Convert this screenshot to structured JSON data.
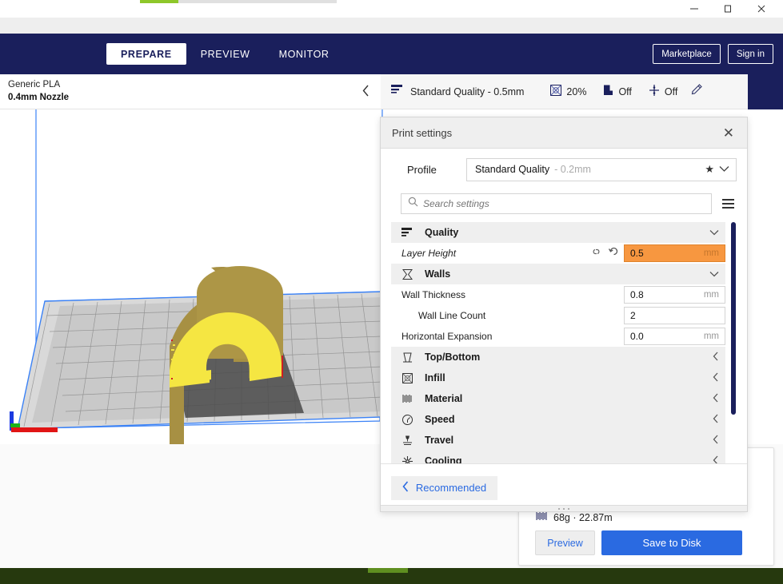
{
  "window": {
    "minimize_label": "minimize",
    "maximize_label": "maximize",
    "close_label": "close"
  },
  "header": {
    "tabs": [
      {
        "label": "PREPARE",
        "active": true
      },
      {
        "label": "PREVIEW",
        "active": false
      },
      {
        "label": "MONITOR",
        "active": false
      }
    ],
    "marketplace_label": "Marketplace",
    "signin_label": "Sign in"
  },
  "config_bar": {
    "material_name": "Generic PLA",
    "nozzle": "0.4mm Nozzle",
    "profile_summary": "Standard Quality - 0.5mm",
    "infill_value": "20%",
    "support_value": "Off",
    "adhesion_value": "Off"
  },
  "dialog": {
    "title": "Print settings",
    "profile_label": "Profile",
    "profile_name": "Standard Quality",
    "profile_sub": "- 0.2mm",
    "search_placeholder": "Search settings",
    "search_value": "",
    "recommended_label": "Recommended",
    "categories": [
      {
        "name": "Quality",
        "icon": "quality-icon",
        "expanded": true,
        "settings": [
          {
            "label": "Layer Height",
            "value": "0.5",
            "unit": "mm",
            "highlighted": true,
            "italic": true,
            "indent": false,
            "has_link_icon": true,
            "has_revert_icon": true
          }
        ]
      },
      {
        "name": "Walls",
        "icon": "walls-icon",
        "expanded": true,
        "settings": [
          {
            "label": "Wall Thickness",
            "value": "0.8",
            "unit": "mm",
            "highlighted": false,
            "italic": false,
            "indent": false,
            "has_link_icon": false,
            "has_revert_icon": false
          },
          {
            "label": "Wall Line Count",
            "value": "2",
            "unit": "",
            "highlighted": false,
            "italic": false,
            "indent": true,
            "has_link_icon": false,
            "has_revert_icon": false
          },
          {
            "label": "Horizontal Expansion",
            "value": "0.0",
            "unit": "mm",
            "highlighted": false,
            "italic": false,
            "indent": false,
            "has_link_icon": false,
            "has_revert_icon": false
          }
        ]
      },
      {
        "name": "Top/Bottom",
        "icon": "topbottom-icon",
        "expanded": false,
        "settings": []
      },
      {
        "name": "Infill",
        "icon": "infill-icon",
        "expanded": false,
        "settings": []
      },
      {
        "name": "Material",
        "icon": "material-icon",
        "expanded": false,
        "settings": []
      },
      {
        "name": "Speed",
        "icon": "speed-icon",
        "expanded": false,
        "settings": []
      },
      {
        "name": "Travel",
        "icon": "travel-icon",
        "expanded": false,
        "settings": []
      },
      {
        "name": "Cooling",
        "icon": "cooling-icon",
        "expanded": false,
        "settings": []
      }
    ]
  },
  "job_card": {
    "material_usage": "68g · 22.87m",
    "preview_label": "Preview",
    "save_label": "Save to Disk"
  },
  "colors": {
    "brand_navy": "#1a1f5c",
    "accent_blue": "#2a6ae1",
    "highlight_orange": "#f79740",
    "model_yellow": "#f5e642",
    "progress_green": "#8ec72a"
  }
}
